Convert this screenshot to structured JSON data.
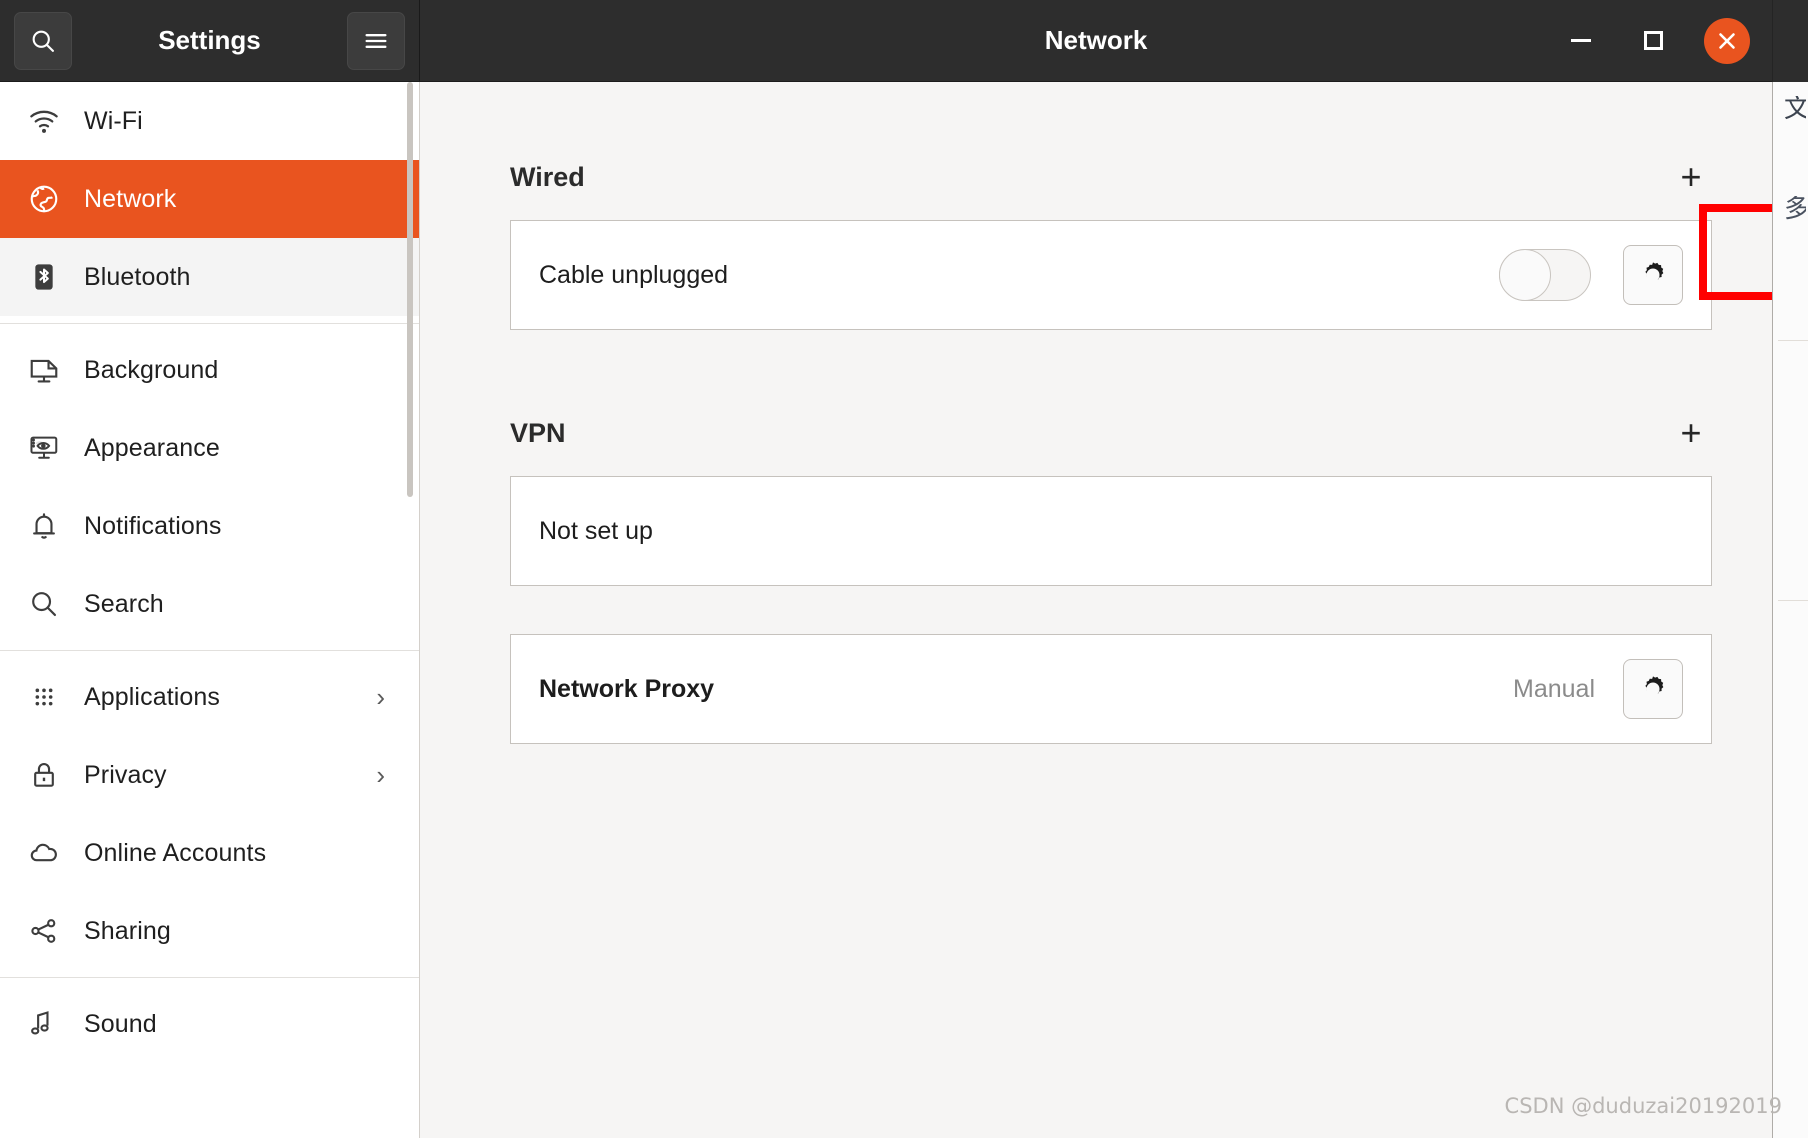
{
  "window": {
    "app_title": "Settings",
    "page_title": "Network",
    "search_icon": "search-icon",
    "menu_icon": "hamburger-menu-icon",
    "minimize_label": "–",
    "maximize_label": "□",
    "close_label": "✕"
  },
  "colors": {
    "accent": "#e9541f",
    "titlebar": "#2d2d2d",
    "content_bg": "#f6f5f4",
    "highlight": "#ff0000"
  },
  "sidebar": {
    "items": [
      {
        "label": "Wi-Fi",
        "icon": "wifi-icon",
        "selected": false,
        "hover": false,
        "chevron": ""
      },
      {
        "label": "Network",
        "icon": "globe-icon",
        "selected": true,
        "hover": false,
        "chevron": ""
      },
      {
        "label": "Bluetooth",
        "icon": "bluetooth-icon",
        "selected": false,
        "hover": true,
        "chevron": ""
      },
      {
        "label": "Background",
        "icon": "monitor-icon",
        "selected": false,
        "hover": false,
        "chevron": ""
      },
      {
        "label": "Appearance",
        "icon": "appearance-icon",
        "selected": false,
        "hover": false,
        "chevron": ""
      },
      {
        "label": "Notifications",
        "icon": "bell-icon",
        "selected": false,
        "hover": false,
        "chevron": ""
      },
      {
        "label": "Search",
        "icon": "search-icon",
        "selected": false,
        "hover": false,
        "chevron": ""
      },
      {
        "label": "Applications",
        "icon": "grid-dots-icon",
        "selected": false,
        "hover": false,
        "chevron": "›"
      },
      {
        "label": "Privacy",
        "icon": "lock-icon",
        "selected": false,
        "hover": false,
        "chevron": "›"
      },
      {
        "label": "Online Accounts",
        "icon": "cloud-icon",
        "selected": false,
        "hover": false,
        "chevron": ""
      },
      {
        "label": "Sharing",
        "icon": "share-icon",
        "selected": false,
        "hover": false,
        "chevron": ""
      },
      {
        "label": "Sound",
        "icon": "sound-icon",
        "selected": false,
        "hover": false,
        "chevron": ""
      }
    ]
  },
  "main": {
    "wired": {
      "title": "Wired",
      "add_label": "+",
      "row_label": "Cable unplugged",
      "toggle_state": "off",
      "settings_icon": "gear-icon"
    },
    "vpn": {
      "title": "VPN",
      "add_label": "+",
      "row_label": "Not set up"
    },
    "proxy": {
      "row_label": "Network Proxy",
      "value": "Manual",
      "settings_icon": "gear-icon"
    }
  },
  "watermark": "CSDN @duduzai20192019"
}
